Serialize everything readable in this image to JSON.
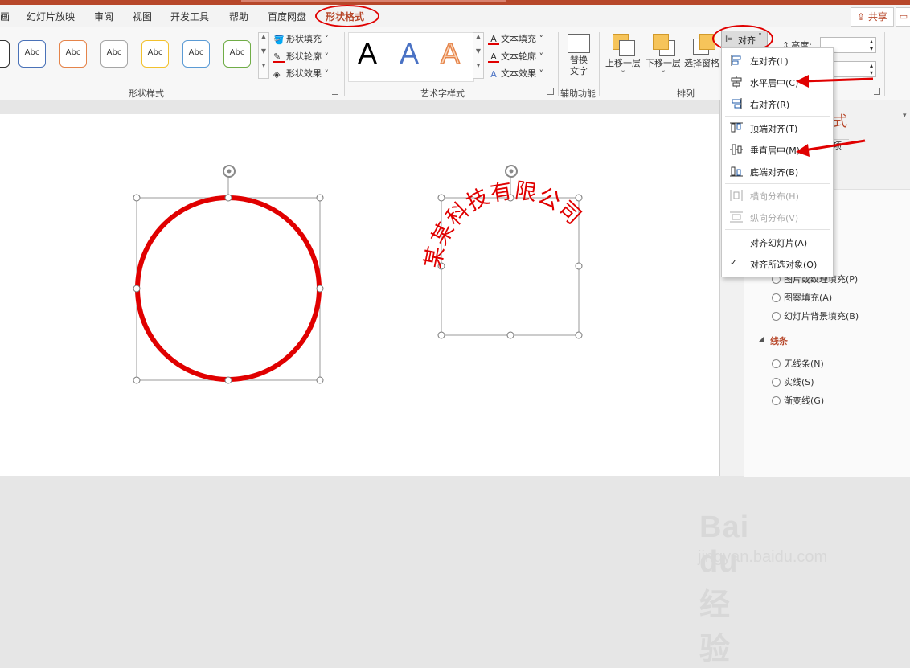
{
  "tabs": [
    "画",
    "幻灯片放映",
    "审阅",
    "视图",
    "开发工具",
    "帮助",
    "百度网盘",
    "形状格式"
  ],
  "share_label": "共享",
  "shape_styles": {
    "swatch_label": "Abc",
    "swatch_colors": [
      "#4a72b8",
      "#e5844a",
      "#a5a5a5",
      "#f2c12e",
      "#5b9bd5",
      "#70ad47"
    ],
    "fill": "形状填充",
    "outline": "形状轮廓",
    "effect": "形状效果",
    "group_label": "形状样式"
  },
  "wordart": {
    "letter": "A",
    "fill": "文本填充",
    "outline": "文本轮廓",
    "effect": "文本效果",
    "group_label": "艺术字样式"
  },
  "accessibility": {
    "alt_text": "替换\n文字",
    "alt_text_line1": "替换",
    "alt_text_line2": "文字",
    "group_label": "辅助功能"
  },
  "arrange": {
    "bring_forward": "上移一层",
    "send_backward": "下移一层",
    "selection_pane": "选择窗格",
    "align": "对齐",
    "group_label": "排列"
  },
  "size": {
    "height_label": "高度:"
  },
  "align_menu": [
    {
      "label": "左对齐(L)",
      "icon": "align-left-icon",
      "enabled": true
    },
    {
      "label": "水平居中(C)",
      "icon": "align-center-icon",
      "enabled": true
    },
    {
      "label": "右对齐(R)",
      "icon": "align-right-icon",
      "enabled": true
    },
    {
      "label": "顶端对齐(T)",
      "icon": "align-top-icon",
      "enabled": true
    },
    {
      "label": "垂直居中(M)",
      "icon": "align-middle-icon",
      "enabled": true
    },
    {
      "label": "底端对齐(B)",
      "icon": "align-bottom-icon",
      "enabled": true
    },
    {
      "label": "横向分布(H)",
      "icon": "distribute-horizontal-icon",
      "enabled": false
    },
    {
      "label": "纵向分布(V)",
      "icon": "distribute-vertical-icon",
      "enabled": false
    },
    {
      "label": "对齐幻灯片(A)",
      "icon": "",
      "enabled": true
    },
    {
      "label": "对齐所选对象(O)",
      "icon": "check-icon",
      "enabled": true
    }
  ],
  "pane": {
    "title_fragment": "式",
    "options": [
      "图片或纹理填充(P)",
      "图案填充(A)",
      "幻灯片背景填充(B)"
    ],
    "line_section": "线条",
    "line_options": [
      "无线条(N)",
      "实线(S)",
      "渐变线(G)"
    ]
  },
  "canvas": {
    "arc_text": "某某科技有限公司",
    "accent_color": "#e00000"
  },
  "watermark": {
    "line1": "Bai du 经验",
    "line2": "jingyan.baidu.com"
  }
}
